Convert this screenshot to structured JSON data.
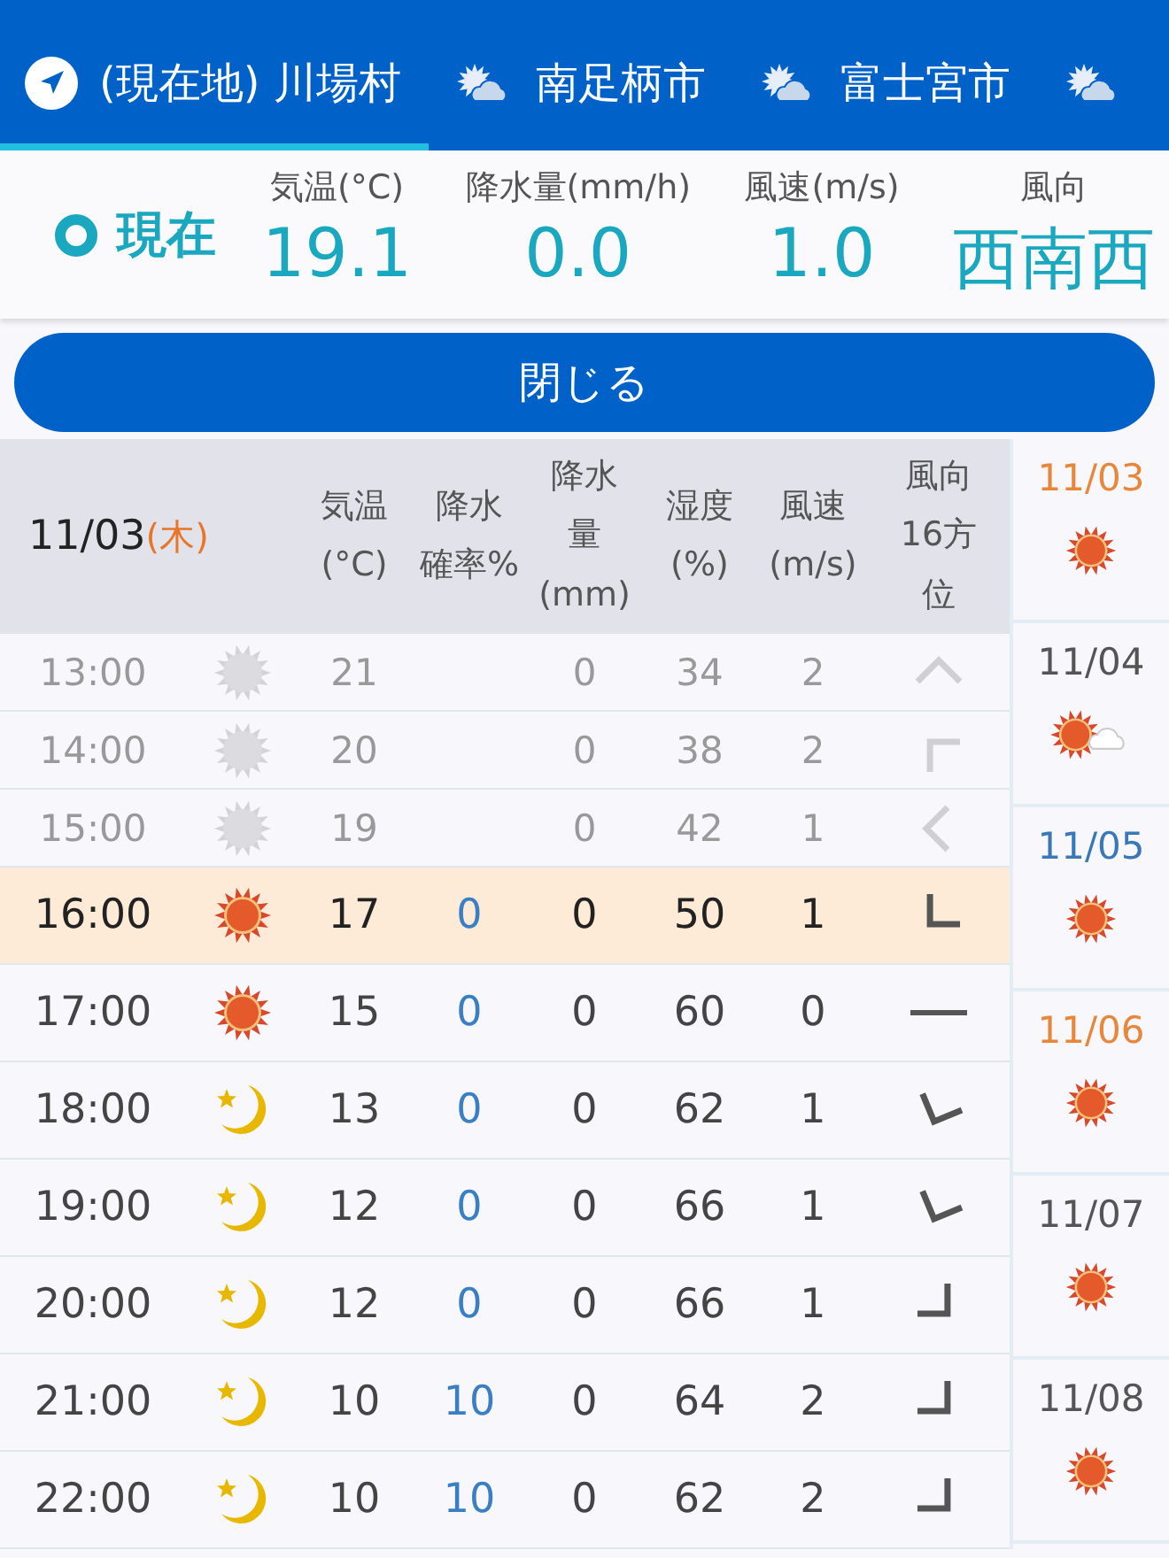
{
  "tabs": [
    {
      "kind": "location",
      "label": "(現在地) 川場村",
      "selected": true
    },
    {
      "kind": "weather",
      "label": "南足柄市",
      "selected": false
    },
    {
      "kind": "weather",
      "label": "富士宮市",
      "selected": false
    },
    {
      "kind": "weather",
      "selected": false
    }
  ],
  "current": {
    "label": "現在",
    "items": [
      {
        "label": "気温(°C)",
        "value": "19.1"
      },
      {
        "label": "降水量(mm/h)",
        "value": "0.0"
      },
      {
        "label": "風速(m/s)",
        "value": "1.0"
      },
      {
        "label": "風向",
        "value": "西南西"
      }
    ]
  },
  "close_button": "閉じる",
  "table": {
    "date": "11/03",
    "weekday": "(木)",
    "columns": [
      {
        "lines": [
          "気温",
          "(°C)"
        ]
      },
      {
        "lines": [
          "降水",
          "確率%"
        ]
      },
      {
        "lines": [
          "降水",
          "量",
          "(mm)"
        ]
      },
      {
        "lines": [
          "湿度",
          "(%)"
        ]
      },
      {
        "lines": [
          "風速",
          "(m/s)"
        ]
      },
      {
        "lines": [
          "風向",
          "16方",
          "位"
        ]
      }
    ],
    "rows": [
      {
        "time": "13:00",
        "weather": {
          "kind": "sun"
        },
        "temp": "21",
        "amount": "0",
        "humidity": "34",
        "speed": "2",
        "wind": {
          "kind": "n"
        },
        "past": true,
        "selected": false
      },
      {
        "time": "14:00",
        "weather": {
          "kind": "sun"
        },
        "temp": "20",
        "amount": "0",
        "humidity": "38",
        "speed": "2",
        "wind": {
          "kind": "nw"
        },
        "past": true,
        "selected": false
      },
      {
        "time": "15:00",
        "weather": {
          "kind": "sun"
        },
        "temp": "19",
        "amount": "0",
        "humidity": "42",
        "speed": "1",
        "wind": {
          "kind": "w"
        },
        "past": true,
        "selected": false
      },
      {
        "time": "16:00",
        "weather": {
          "kind": "sun"
        },
        "temp": "17",
        "prob": "0",
        "amount": "0",
        "humidity": "50",
        "speed": "1",
        "wind": {
          "kind": "sw"
        },
        "past": false,
        "selected": true
      },
      {
        "time": "17:00",
        "weather": {
          "kind": "sun"
        },
        "temp": "15",
        "prob": "0",
        "amount": "0",
        "humidity": "60",
        "speed": "0",
        "wind": {
          "kind": "calm"
        },
        "past": false,
        "selected": false
      },
      {
        "time": "18:00",
        "weather": {
          "kind": "moon"
        },
        "temp": "13",
        "prob": "0",
        "amount": "0",
        "humidity": "62",
        "speed": "1",
        "wind": {
          "kind": "ssw"
        },
        "past": false,
        "selected": false
      },
      {
        "time": "19:00",
        "weather": {
          "kind": "moon"
        },
        "temp": "12",
        "prob": "0",
        "amount": "0",
        "humidity": "66",
        "speed": "1",
        "wind": {
          "kind": "ssw"
        },
        "past": false,
        "selected": false
      },
      {
        "time": "20:00",
        "weather": {
          "kind": "moon"
        },
        "temp": "12",
        "prob": "0",
        "amount": "0",
        "humidity": "66",
        "speed": "1",
        "wind": {
          "kind": "se"
        },
        "past": false,
        "selected": false
      },
      {
        "time": "21:00",
        "weather": {
          "kind": "moon"
        },
        "temp": "10",
        "prob": "10",
        "amount": "0",
        "humidity": "64",
        "speed": "2",
        "wind": {
          "kind": "se"
        },
        "past": false,
        "selected": false
      },
      {
        "time": "22:00",
        "weather": {
          "kind": "moon"
        },
        "temp": "10",
        "prob": "10",
        "amount": "0",
        "humidity": "62",
        "speed": "2",
        "wind": {
          "kind": "se"
        },
        "past": false,
        "selected": false
      }
    ]
  },
  "days": [
    {
      "date": "11/03",
      "kind": "holiday",
      "weather": {
        "kind": "sun"
      }
    },
    {
      "date": "11/04",
      "kind": "weekday",
      "weather": {
        "kind": "sun_cloud"
      }
    },
    {
      "date": "11/05",
      "kind": "saturday",
      "weather": {
        "kind": "sun"
      }
    },
    {
      "date": "11/06",
      "kind": "holiday",
      "weather": {
        "kind": "sun"
      }
    },
    {
      "date": "11/07",
      "kind": "weekday",
      "weather": {
        "kind": "sun"
      }
    },
    {
      "date": "11/08",
      "kind": "weekday",
      "weather": {
        "kind": "sun"
      }
    }
  ]
}
